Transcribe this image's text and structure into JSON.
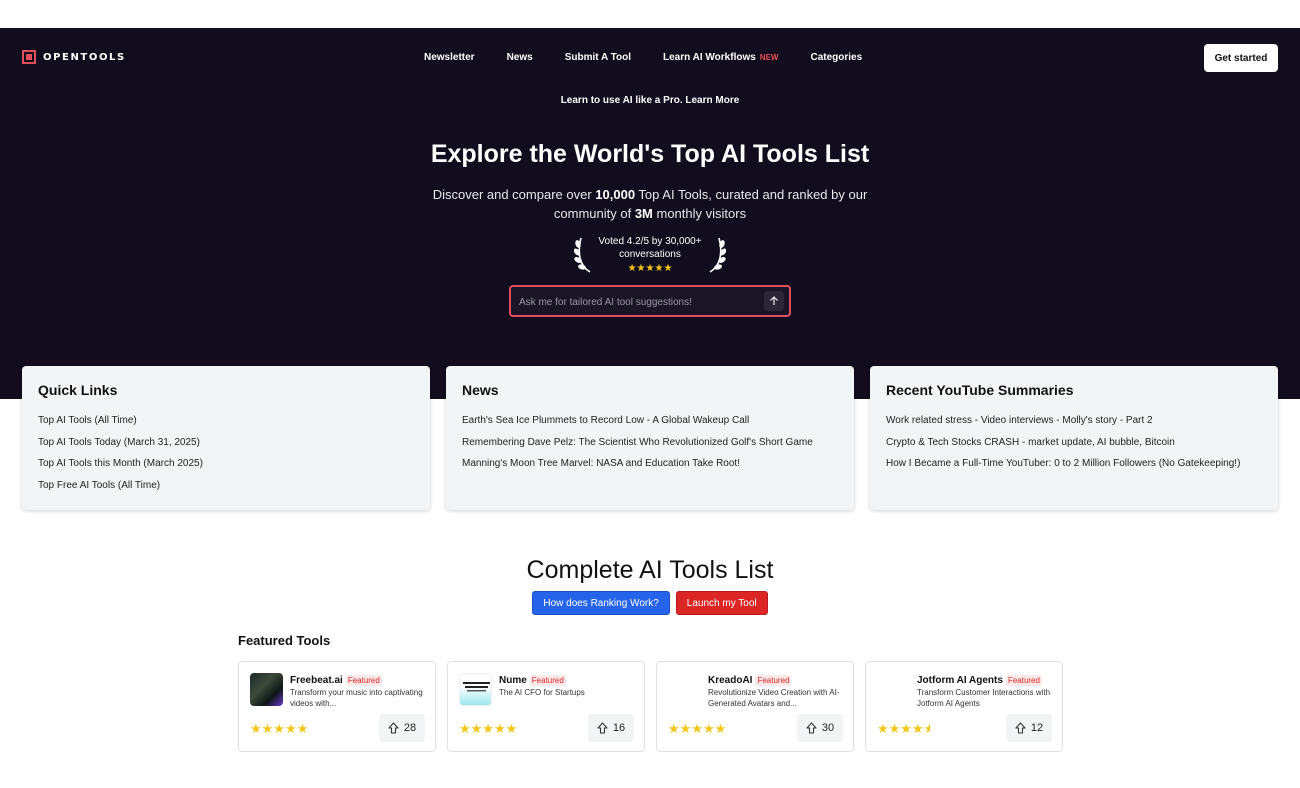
{
  "header": {
    "logo_text": "OPENTOOLS",
    "nav": [
      {
        "label": "Newsletter"
      },
      {
        "label": "News"
      },
      {
        "label": "Submit A Tool"
      },
      {
        "label": "Learn AI Workflows",
        "badge": "NEW"
      },
      {
        "label": "Categories"
      }
    ],
    "cta_label": "Get started"
  },
  "hero": {
    "promo": "Learn to use AI like a Pro. Learn More",
    "title": "Explore the World's Top AI Tools List",
    "sub_1": "Discover and compare over ",
    "sub_count": "10,000",
    "sub_2": " Top AI Tools, curated and ranked by our community of ",
    "sub_visitors": "3M",
    "sub_3": " monthly visitors",
    "votes_text": "Voted 4.2/5 by 30,000+ conversations",
    "votes_stars": "★★★★★",
    "search_placeholder": "Ask me for tailored AI tool suggestions!"
  },
  "cards": [
    {
      "title": "Quick Links",
      "links": [
        "Top AI Tools (All Time)",
        "Top AI Tools Today (March 31, 2025)",
        "Top AI Tools this Month (March 2025)",
        "Top Free AI Tools (All Time)"
      ]
    },
    {
      "title": "News",
      "links": [
        "Earth's Sea Ice Plummets to Record Low - A Global Wakeup Call",
        "Remembering Dave Pelz: The Scientist Who Revolutionized Golf's Short Game",
        "Manning's Moon Tree Marvel: NASA and Education Take Root!"
      ]
    },
    {
      "title": "Recent YouTube Summaries",
      "links": [
        "Work related stress - Video interviews - Molly's story - Part 2",
        "Crypto & Tech Stocks CRASH - market update, AI bubble, Bitcoin",
        "How I Became a Full-Time YouTuber: 0 to 2 Million Followers (No Gatekeeping!)"
      ]
    }
  ],
  "list": {
    "title": "Complete AI Tools List",
    "ranking_button": "How does Ranking Work?",
    "launch_button": "Launch my Tool",
    "featured_heading": "Featured Tools"
  },
  "tools": [
    {
      "name": "Freebeat.ai",
      "badge": "Featured",
      "desc": "Transform your music into captivating videos with...",
      "stars": "★★★★★",
      "rating": 5,
      "upvotes": "28"
    },
    {
      "name": "Nume",
      "badge": "Featured",
      "desc": "The AI CFO for Startups",
      "stars": "★★★★★",
      "rating": 5,
      "upvotes": "16"
    },
    {
      "name": "KreadoAI",
      "badge": "Featured",
      "desc": "Revolutionize Video Creation with AI-Generated Avatars and...",
      "stars": "★★★★★",
      "rating": 5,
      "upvotes": "30"
    },
    {
      "name": "Jotform AI Agents",
      "badge": "Featured",
      "desc": "Transform Customer Interactions with Jotform AI Agents",
      "stars": "★★★★",
      "rating": 4.5,
      "upvotes": "12"
    }
  ],
  "colors": {
    "hero_bg": "#120d1e",
    "accent_red": "#e0505b",
    "star": "#f5c518",
    "primary_blue": "#2563eb",
    "danger_red": "#dc2626"
  }
}
